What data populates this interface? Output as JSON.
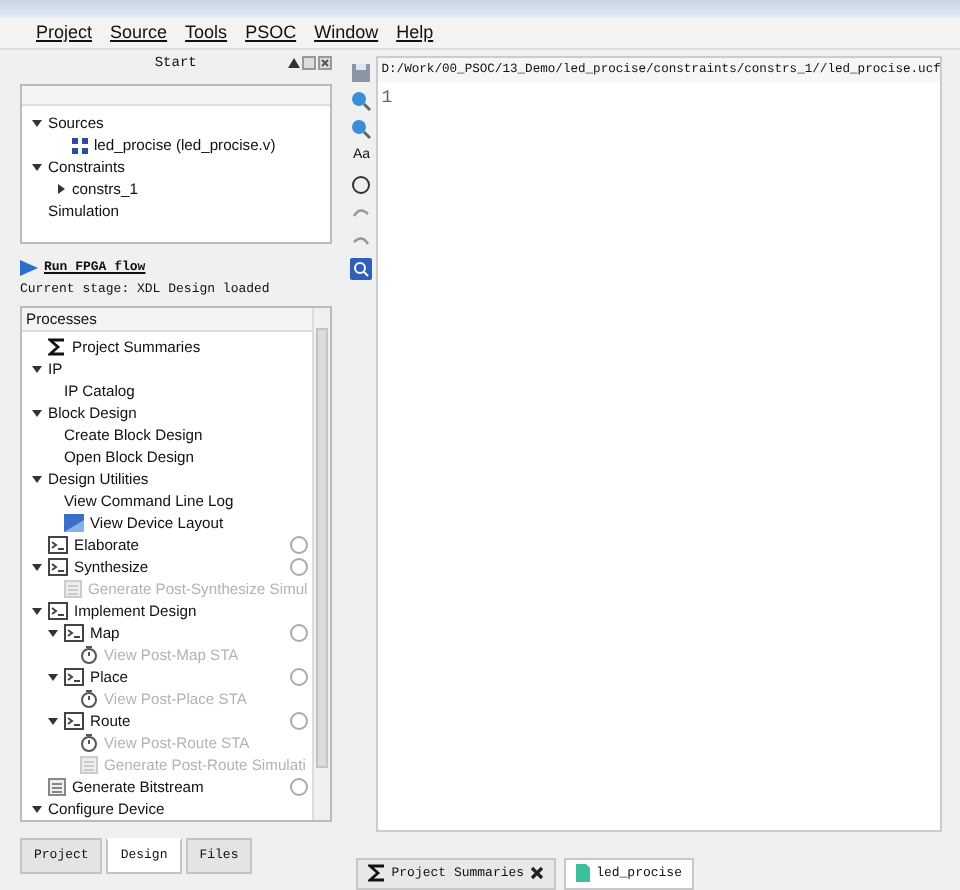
{
  "menu": [
    "Project",
    "Source",
    "Tools",
    "PSOC",
    "Window",
    "Help"
  ],
  "start_panel": {
    "title": "Start"
  },
  "sources_tree": [
    {
      "label": "Sources",
      "expanded": true,
      "children": [
        {
          "label": "led_procise (led_procise.v)",
          "kind": "module"
        }
      ]
    },
    {
      "label": "Constraints",
      "expanded": true,
      "children": [
        {
          "label": "constrs_1",
          "expanded": false
        }
      ]
    },
    {
      "label": "Simulation"
    }
  ],
  "run_flow": "Run FPGA flow",
  "current_stage": "Current stage: XDL Design loaded",
  "processes": {
    "title": "Processes",
    "items": [
      {
        "label": "Project Summaries",
        "kind": "summary"
      },
      {
        "label": "IP",
        "expanded": true,
        "children": [
          {
            "label": "IP Catalog"
          }
        ]
      },
      {
        "label": "Block Design",
        "expanded": true,
        "children": [
          {
            "label": "Create Block Design"
          },
          {
            "label": "Open Block Design"
          }
        ]
      },
      {
        "label": "Design Utilities",
        "expanded": true,
        "children": [
          {
            "label": "View Command Line Log"
          },
          {
            "label": "View Device Layout",
            "kind": "layout"
          }
        ]
      },
      {
        "label": "Elaborate",
        "kind": "task",
        "status_circle": true
      },
      {
        "label": "Synthesize",
        "kind": "task",
        "status_circle": true,
        "expanded": true,
        "children": [
          {
            "label": "Generate Post-Synthesize Simul",
            "kind": "generate",
            "disabled": true
          }
        ]
      },
      {
        "label": "Implement Design",
        "kind": "task",
        "expanded": true,
        "children": [
          {
            "label": "Map",
            "kind": "task",
            "status_circle": true,
            "expanded": true,
            "children": [
              {
                "label": "View Post-Map STA",
                "kind": "timer",
                "disabled": true
              }
            ]
          },
          {
            "label": "Place",
            "kind": "task",
            "status_circle": true,
            "expanded": true,
            "children": [
              {
                "label": "View Post-Place STA",
                "kind": "timer",
                "disabled": true
              }
            ]
          },
          {
            "label": "Route",
            "kind": "task",
            "status_circle": true,
            "expanded": true,
            "children": [
              {
                "label": "View Post-Route STA",
                "kind": "timer",
                "disabled": true
              },
              {
                "label": "Generate Post-Route Simulati",
                "kind": "generate",
                "disabled": true
              }
            ]
          }
        ]
      },
      {
        "label": "Generate Bitstream",
        "kind": "generate",
        "status_circle": true,
        "disabled": false
      },
      {
        "label": "Configure Device",
        "expanded": true
      }
    ]
  },
  "left_tabs": [
    {
      "label": "Project",
      "selected": false
    },
    {
      "label": "Design",
      "selected": true
    },
    {
      "label": "Files",
      "selected": false
    }
  ],
  "editor": {
    "path": "D:/Work/00_PSOC/13_Demo/led_procise/constraints/constrs_1//led_procise.ucf",
    "line_numbers": [
      "1"
    ],
    "toolbar_text": "Aa"
  },
  "editor_tabs": [
    {
      "label": "Project Summaries",
      "kind": "summary",
      "closable": true,
      "selected": false
    },
    {
      "label": "led_procise",
      "kind": "file",
      "closable": false,
      "selected": true
    }
  ]
}
